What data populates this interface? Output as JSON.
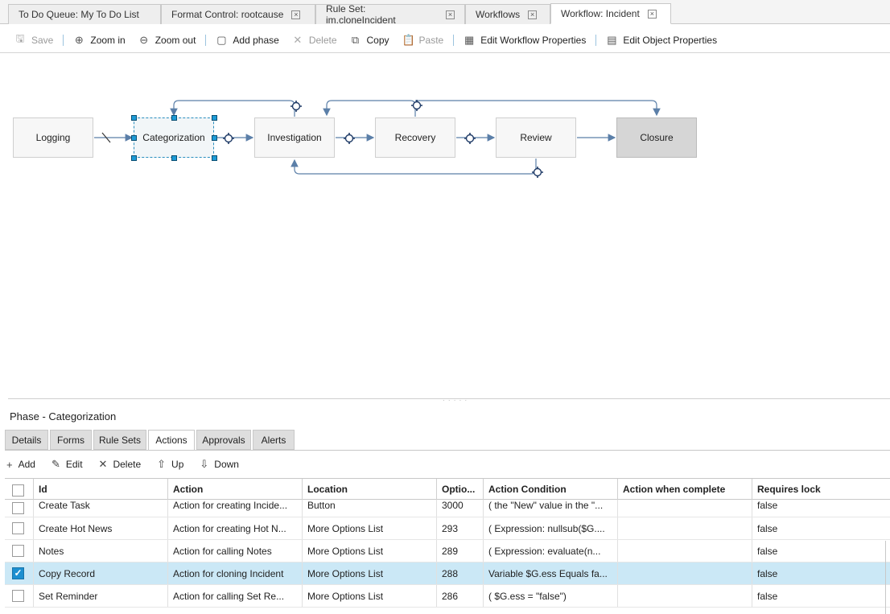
{
  "tabs": [
    {
      "label": "To Do Queue: My To Do List",
      "closable": false
    },
    {
      "label": "Format Control: rootcause",
      "closable": true
    },
    {
      "label": "Rule Set: im.cloneIncident",
      "closable": true
    },
    {
      "label": "Workflows",
      "closable": true
    },
    {
      "label": "Workflow: Incident",
      "closable": true,
      "active": true
    }
  ],
  "toolbar": {
    "save": "Save",
    "zoom_in": "Zoom in",
    "zoom_out": "Zoom out",
    "add_phase": "Add phase",
    "delete": "Delete",
    "copy": "Copy",
    "paste": "Paste",
    "edit_workflow_properties": "Edit Workflow Properties",
    "edit_object_properties": "Edit Object Properties"
  },
  "workflow": {
    "phases": [
      "Logging",
      "Categorization",
      "Investigation",
      "Recovery",
      "Review",
      "Closure"
    ],
    "start_phase": "Logging",
    "selected_phase": "Categorization",
    "colors": {
      "connector": "#5b7fa8",
      "start_arrow": "#1e9bd6",
      "check": "#3aa040",
      "selection": "#1e9bd6"
    }
  },
  "panel": {
    "title": "Phase - Categorization",
    "subtabs": [
      "Details",
      "Forms",
      "Rule Sets",
      "Actions",
      "Approvals",
      "Alerts"
    ],
    "active_subtab": "Actions",
    "actions": {
      "add": "Add",
      "edit": "Edit",
      "delete": "Delete",
      "up": "Up",
      "down": "Down"
    }
  },
  "grid": {
    "columns": [
      "Id",
      "Action",
      "Location",
      "Optio...",
      "Action Condition",
      "Action when complete",
      "Requires lock"
    ],
    "rows": [
      {
        "id": "Create Task",
        "action": "Action for creating Incide...",
        "location": "Button",
        "option": "3000",
        "condition": "( the \"New\" value in the \"...",
        "complete": "",
        "lock": "false",
        "checked": false
      },
      {
        "id": "Create Hot News",
        "action": "Action for creating Hot N...",
        "location": "More Options List",
        "option": "293",
        "condition": "( Expression: nullsub($G....",
        "complete": "",
        "lock": "false",
        "checked": false
      },
      {
        "id": "Notes",
        "action": "Action for calling Notes",
        "location": "More Options List",
        "option": "289",
        "condition": "( Expression: evaluate(n...",
        "complete": "",
        "lock": "false",
        "checked": false
      },
      {
        "id": "Copy Record",
        "action": "Action for cloning Incident",
        "location": "More Options List",
        "option": "288",
        "condition": "Variable $G.ess Equals fa...",
        "complete": "",
        "lock": "false",
        "checked": true
      },
      {
        "id": "Set Reminder",
        "action": "Action for calling Set Re...",
        "location": "More Options List",
        "option": "286",
        "condition": "( $G.ess = \"false\")",
        "complete": "",
        "lock": "false",
        "checked": false
      }
    ]
  }
}
